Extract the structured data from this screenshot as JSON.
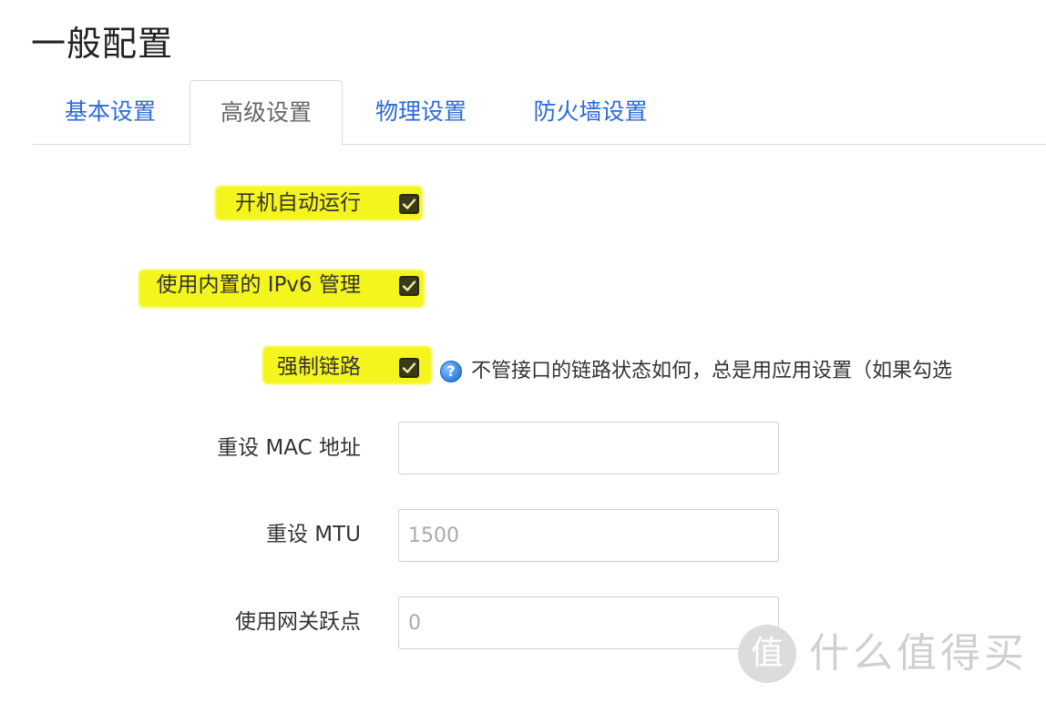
{
  "page": {
    "title": "一般配置"
  },
  "tabs": [
    {
      "label": "基本设置",
      "active": false
    },
    {
      "label": "高级设置",
      "active": true
    },
    {
      "label": "物理设置",
      "active": false
    },
    {
      "label": "防火墙设置",
      "active": false
    }
  ],
  "settings": {
    "auto_start": {
      "label": "开机自动运行",
      "checked": true
    },
    "builtin_ipv6": {
      "label": "使用内置的 IPv6 管理",
      "checked": true
    },
    "force_link": {
      "label": "强制链路",
      "checked": true,
      "help": "不管接口的链路状态如何，总是用应用设置（如果勾选"
    },
    "mac_override": {
      "label": "重设 MAC 地址",
      "value": "",
      "placeholder": ""
    },
    "mtu_override": {
      "label": "重设 MTU",
      "value": "",
      "placeholder": "1500"
    },
    "gateway_metric": {
      "label": "使用网关跃点",
      "value": "",
      "placeholder": "0"
    }
  },
  "watermark": {
    "logo_char": "值",
    "text": "什么值得买"
  },
  "colors": {
    "tab_link": "#2a6ad8",
    "tab_active": "#666666",
    "highlight": "#f5f51e",
    "checkbox": "#3b3b1a",
    "help_icon": "#2d7de0"
  }
}
